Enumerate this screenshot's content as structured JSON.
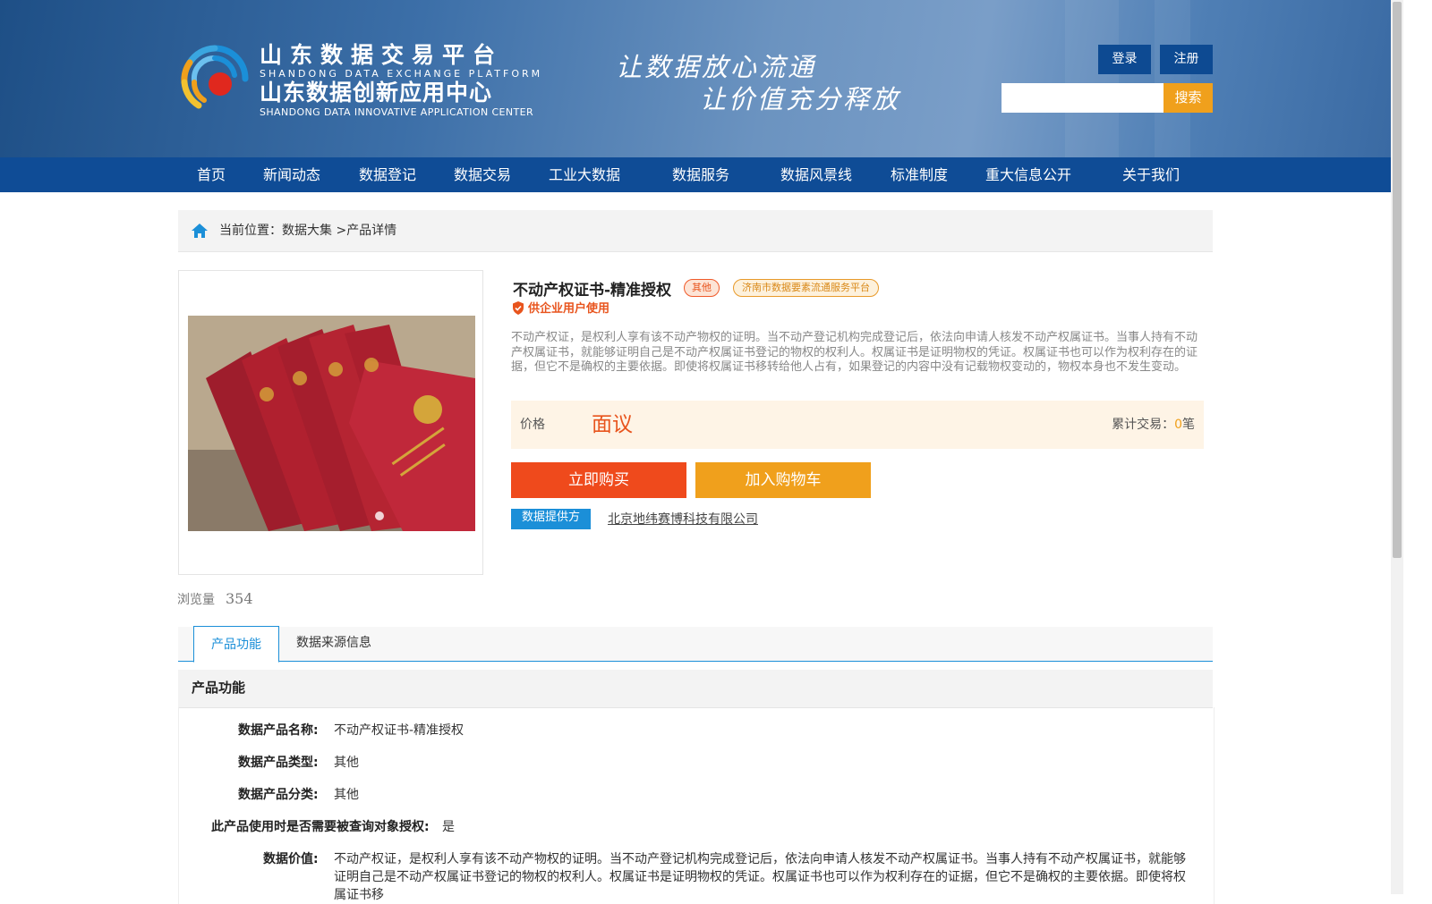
{
  "header": {
    "brand_cn1": "山东数据交易平台",
    "brand_en1": "SHANDONG DATA EXCHANGE PLATFORM",
    "brand_cn2": "山东数据创新应用中心",
    "brand_en2": "SHANDONG DATA INNOVATIVE APPLICATION CENTER",
    "slogan_line1": "让数据放心流通",
    "slogan_line2": "让价值充分释放",
    "login_label": "登录",
    "register_label": "注册",
    "search_placeholder": "",
    "search_label": "搜索"
  },
  "nav": [
    "首页",
    "新闻动态",
    "数据登记",
    "数据交易",
    "工业大数据",
    "数据服务",
    "数据风景线",
    "标准制度",
    "重大信息公开",
    "关于我们"
  ],
  "breadcrumb": {
    "prefix": "当前位置：",
    "level1": "数据大集",
    "sep": ">",
    "level2": "产品详情"
  },
  "product": {
    "title": "不动产权证书-精准授权",
    "tag_category": "其他",
    "tag_platform": "济南市数据要素流通服务平台",
    "enterprise_only": "供企业用户使用",
    "description": "不动产权证，是权利人享有该不动产物权的证明。当不动产登记机构完成登记后，依法向申请人核发不动产权属证书。当事人持有不动产权属证书，就能够证明自己是不动产权属证书登记的物权的权利人。权属证书是证明物权的凭证。权属证书也可以作为权利存在的证据，但它不是确权的主要依据。即使将权属证书移转给他人占有，如果登记的内容中没有记载物权变动的，物权本身也不发生变动。",
    "price_label": "价格",
    "price_value": "面议",
    "trade_label": "累计交易：",
    "trade_count": "0",
    "trade_unit": "笔",
    "buy_label": "立即购买",
    "cart_label": "加入购物车",
    "provider_tag": "数据提供方",
    "provider_name": "北京地纬赛博科技有限公司",
    "views_label": "浏览量",
    "views_count": "354"
  },
  "tabs": [
    "产品功能",
    "数据来源信息"
  ],
  "section": {
    "title": "产品功能",
    "rows": [
      {
        "key": "数据产品名称:",
        "value": "不动产权证书-精准授权"
      },
      {
        "key": "数据产品类型:",
        "value": "其他"
      },
      {
        "key": "数据产品分类:",
        "value": "其他"
      },
      {
        "key": "此产品使用时是否需要被查询对象授权:",
        "value": "是"
      },
      {
        "key": "数据价值:",
        "value": "不动产权证，是权利人享有该不动产物权的证明。当不动产登记机构完成登记后，依法向申请人核发不动产权属证书。当事人持有不动产权属证书，就能够证明自己是不动产权属证书登记的物权的权利人。权属证书是证明物权的凭证。权属证书也可以作为权利存在的证据，但它不是确权的主要依据。即使将权属证书移"
      }
    ]
  },
  "colors": {
    "nav_bg": "#0f4c96",
    "accent_orange": "#f0a01c",
    "accent_red": "#ef4a1c",
    "accent_blue": "#1b8fd8"
  }
}
